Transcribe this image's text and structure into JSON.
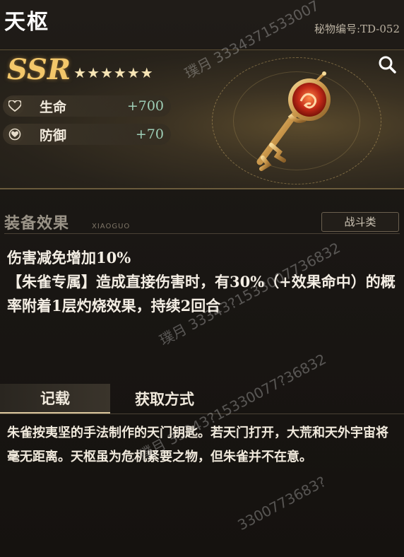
{
  "header": {
    "title": "天枢",
    "serial": "秘物编号:TD-052"
  },
  "hero": {
    "rarity": "SSR",
    "stars": "★★★★★★",
    "star_count": 6,
    "stats": [
      {
        "icon": "heart-icon",
        "label": "生命",
        "value": "+700"
      },
      {
        "icon": "shield-heart-icon",
        "label": "防御",
        "value": "+70"
      }
    ],
    "zoom_icon": "magnifier-icon"
  },
  "equipment": {
    "title": "装备效果",
    "subtitle": "XIAOGUO",
    "category": "战斗类",
    "effect_lines": [
      "伤害减免增加10%",
      "【朱雀专属】造成直接伤害时，有30%（+效果命中）的概率附着1层灼烧效果，持续2回合"
    ]
  },
  "tabs": [
    {
      "label": "记载",
      "active": true
    },
    {
      "label": "获取方式",
      "active": false
    }
  ],
  "lore": "朱雀按夷坚的手法制作的天门钥匙。若天门打开，大荒和天外宇宙将毫无距离。天枢虽为危机紧要之物，但朱雀并不在意。",
  "watermarks": [
    "璞月 3334371533007",
    "璞月 33343?1533007736832",
    "璞月 33343?15330077?36832",
    "3300773683?"
  ],
  "colors": {
    "rarity": "#f3c76a",
    "stat_value": "#9fd0b8",
    "accent_gold": "#d8c49b"
  }
}
